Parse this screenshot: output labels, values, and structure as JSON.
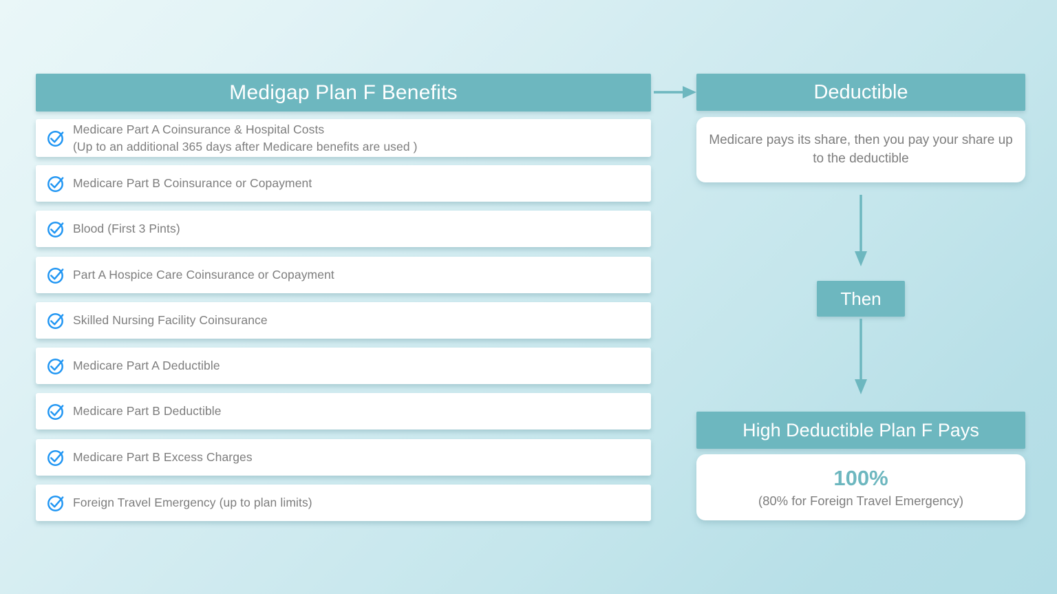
{
  "colors": {
    "teal": "#6db7bf",
    "check_blue": "#2196f3",
    "text_grey": "#7d7d7d",
    "card_white": "#ffffff",
    "bg_light": "#eaf7f8",
    "bg_dark": "#b2dde6"
  },
  "left": {
    "header": "Medigap Plan F Benefits",
    "benefits": [
      {
        "icon": "check-circle-icon",
        "line1": "Medicare Part A Coinsurance & Hospital Costs",
        "line2": "(Up to an additional 365 days after Medicare benefits are used )"
      },
      {
        "icon": "check-circle-icon",
        "line1": "Medicare Part B Coinsurance or Copayment",
        "line2": ""
      },
      {
        "icon": "check-circle-icon",
        "line1": "Blood (First 3 Pints)",
        "line2": ""
      },
      {
        "icon": "check-circle-icon",
        "line1": "Part A Hospice Care Coinsurance or Copayment",
        "line2": ""
      },
      {
        "icon": "check-circle-icon",
        "line1": "Skilled Nursing Facility Coinsurance",
        "line2": ""
      },
      {
        "icon": "check-circle-icon",
        "line1": "Medicare Part A Deductible",
        "line2": ""
      },
      {
        "icon": "check-circle-icon",
        "line1": "Medicare Part B Deductible",
        "line2": ""
      },
      {
        "icon": "check-circle-icon",
        "line1": "Medicare Part B Excess Charges",
        "line2": ""
      },
      {
        "icon": "check-circle-icon",
        "line1": "Foreign Travel Emergency (up to plan limits)",
        "line2": ""
      }
    ]
  },
  "connector": {
    "horizontal_arrow": "arrow-right-icon",
    "down_arrow_1": "arrow-down-icon",
    "down_arrow_2": "arrow-down-icon"
  },
  "right": {
    "deductible_header": "Deductible",
    "deductible_body": "Medicare pays its share, then you pay your share up to the deductible",
    "then_label": "Then",
    "pays_header": "High Deductible Plan F Pays",
    "pays_percent": "100%",
    "pays_note": "(80% for Foreign Travel Emergency)"
  }
}
